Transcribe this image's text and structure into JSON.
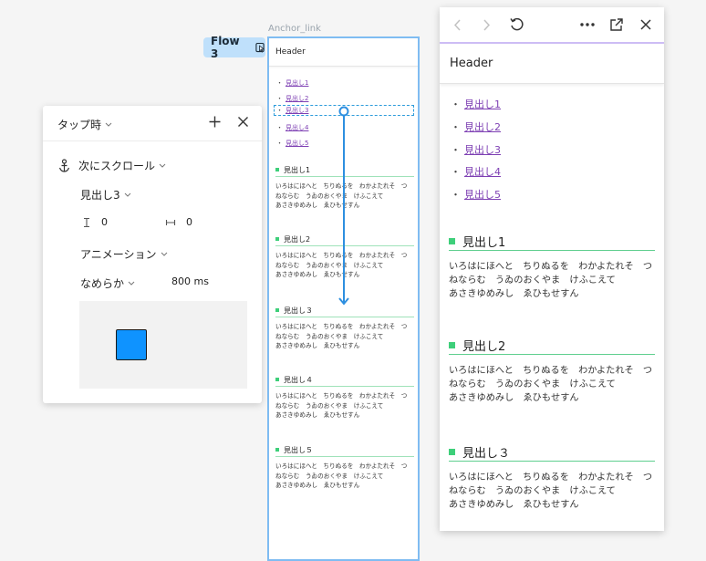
{
  "canvas": {
    "frame_label": "Anchor_link",
    "flow_badge": "Flow 3",
    "frame_header": "Header"
  },
  "links": [
    "見出し1",
    "見出し2",
    "見出し3",
    "見出し4",
    "見出し5"
  ],
  "sections": [
    {
      "heading": "見出し1",
      "lines": [
        "いろはにほへと　ちりぬるを　わかよたれそ　つ",
        "ねならむ　うゐのおくやま　けふこえて",
        "あさきゆめみし　ゑひもせすん"
      ]
    },
    {
      "heading": "見出し2",
      "lines": [
        "いろはにほへと　ちりぬるを　わかよたれそ　つ",
        "ねならむ　うゐのおくやま　けふこえて",
        "あさきゆめみし　ゑひもせすん"
      ]
    },
    {
      "heading": "見出し３",
      "lines": [
        "いろはにほへと　ちりぬるを　わかよたれそ　つ",
        "ねならむ　うゐのおくやま　けふこえて",
        "あさきゆめみし　ゑひもせすん"
      ]
    },
    {
      "heading": "見出し４",
      "lines": [
        "いろはにほへと　ちりぬるを　わかよたれそ　つ",
        "ねならむ　うゐのおくやま　けふこえて",
        "あさきゆめみし　ゑひもせすん"
      ]
    },
    {
      "heading": "見出し５",
      "lines": [
        "いろはにほへと　ちりぬるを　わかよたれそ　つ",
        "ねならむ　うゐのおくやま　けふこえて",
        "あさきゆめみし　ゑひもせすん"
      ]
    }
  ],
  "panel": {
    "trigger": "タップ時",
    "action": "次にスクロール",
    "destination": "見出し3",
    "offset_x": "0",
    "offset_y": "0",
    "animation": "アニメーション",
    "easing": "なめらか",
    "duration": "800 ms"
  },
  "preview": {
    "header": "Header"
  },
  "colors": {
    "accent": "#0f93ff",
    "link": "#7d3fb3",
    "heading_marker": "#3ecf7a",
    "frame_border": "#7fbcf2",
    "flow_badge_bg": "#bfe0fb"
  }
}
